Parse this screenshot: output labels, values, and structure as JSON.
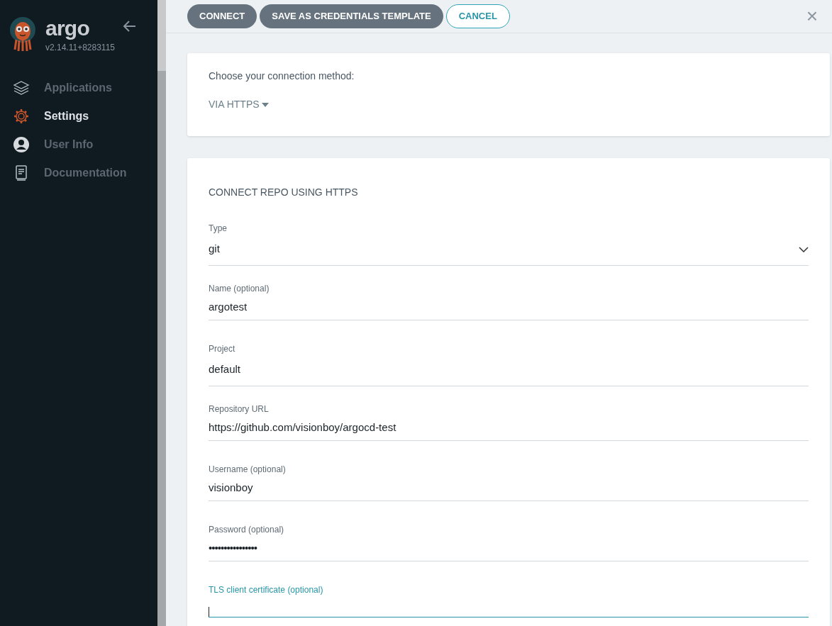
{
  "sidebar": {
    "logo": {
      "name": "argo",
      "version": "v2.14.11+8283115"
    },
    "items": [
      {
        "label": "Applications",
        "kind": "layers",
        "selected": false
      },
      {
        "label": "Settings",
        "kind": "gear",
        "selected": true
      },
      {
        "label": "User Info",
        "kind": "user",
        "selected": false
      },
      {
        "label": "Documentation",
        "kind": "book",
        "selected": false
      }
    ]
  },
  "toolbar": {
    "buttons": [
      {
        "label": "CONNECT",
        "kind": "filled"
      },
      {
        "label": "SAVE AS CREDENTIALS TEMPLATE",
        "kind": "filled"
      },
      {
        "label": "CANCEL",
        "kind": "outline"
      }
    ],
    "close": "×"
  },
  "method_card": {
    "prompt": "Choose your connection method:",
    "method": "VIA HTTPS"
  },
  "form": {
    "title": "CONNECT REPO USING HTTPS",
    "fields": [
      {
        "label": "Type",
        "value": "git",
        "kind": "select",
        "focused": false
      },
      {
        "label": "Name (optional)",
        "value": "argotest",
        "kind": "text",
        "focused": false
      },
      {
        "label": "Project",
        "value": "default",
        "kind": "select-plain",
        "focused": false
      },
      {
        "label": "Repository URL",
        "value": "https://github.com/visionboy/argocd-test",
        "kind": "text",
        "focused": false
      },
      {
        "label": "Username (optional)",
        "value": "visionboy",
        "kind": "text",
        "focused": false
      },
      {
        "label": "Password (optional)",
        "value": "••••••••••••••••",
        "kind": "password",
        "focused": false
      },
      {
        "label": "TLS client certificate (optional)",
        "kind": "textarea",
        "focused": true
      }
    ]
  }
}
